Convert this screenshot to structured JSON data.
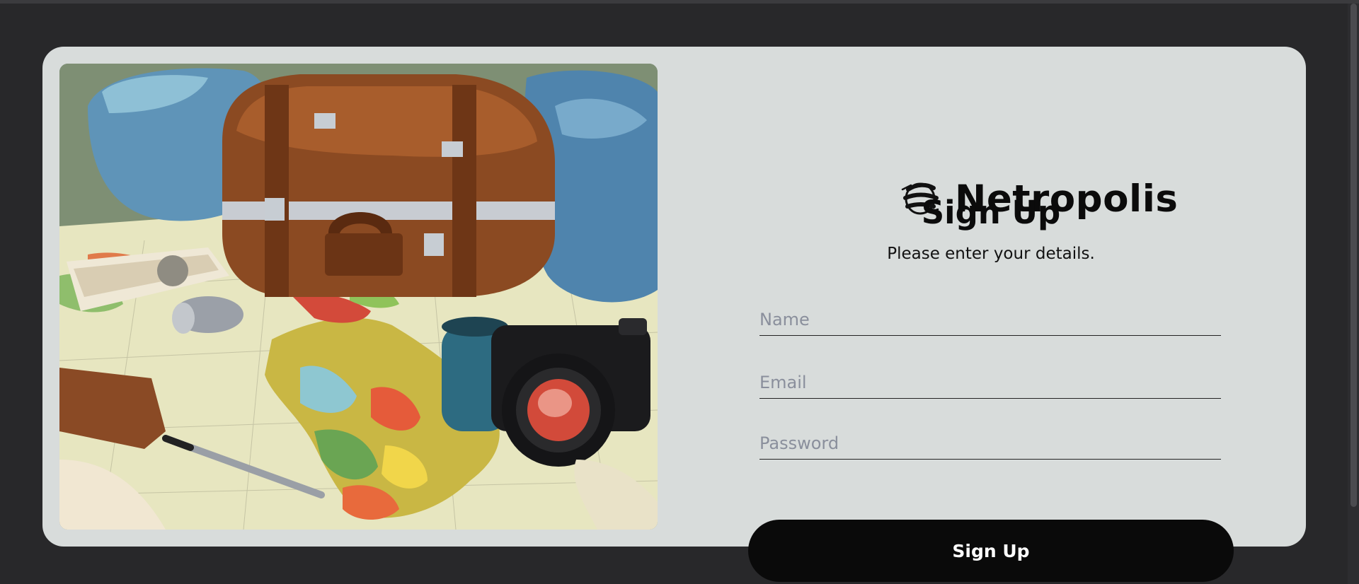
{
  "brand": {
    "name": "Netropolis",
    "logo_icon": "globe-swirl-icon"
  },
  "form": {
    "title": "Sign Up",
    "subtitle": "Please enter your details.",
    "name_placeholder": "Name",
    "email_placeholder": "Email",
    "password_placeholder": "Password",
    "submit_label": "Sign Up"
  },
  "hero_image": {
    "subject": "travel-illustration"
  },
  "colors": {
    "background": "#28282a",
    "card": "#d8dcdb",
    "button": "#0a0a0a",
    "text": "#0b0b0b"
  }
}
